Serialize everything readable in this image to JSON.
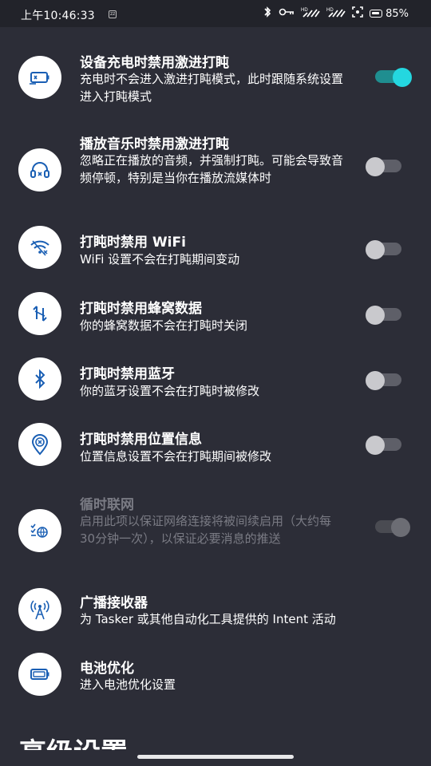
{
  "status_bar": {
    "time": "上午10:46:33",
    "zz_badge": "zz",
    "network1": "HD 2/4G",
    "network2": "HD 2/4G",
    "battery_percent": "85%"
  },
  "settings": [
    {
      "id": "disable-aggressive-charging",
      "title": "设备充电时禁用激进打盹",
      "desc": "充电时不会进入激进打盹模式，此时跟随系统设置进入打盹模式",
      "toggle": "on",
      "icon": "battery-charging-icon",
      "enabled": true
    },
    {
      "id": "disable-aggressive-music",
      "title": "播放音乐时禁用激进打盹",
      "desc": "忽略正在播放的音频，并强制打盹。可能会导致音频停顿，特别是当你在播放流媒体时",
      "toggle": "off",
      "icon": "headphones-icon",
      "enabled": true
    },
    {
      "id": "disable-wifi",
      "title": "打盹时禁用 WiFi",
      "desc": "WiFi 设置不会在打盹期间变动",
      "toggle": "off",
      "icon": "wifi-off-icon",
      "enabled": true
    },
    {
      "id": "disable-cellular",
      "title": "打盹时禁用蜂窝数据",
      "desc": "你的蜂窝数据不会在打盹时关闭",
      "toggle": "off",
      "icon": "cellular-data-icon",
      "enabled": true
    },
    {
      "id": "disable-bluetooth",
      "title": "打盹时禁用蓝牙",
      "desc": "你的蓝牙设置不会在打盹时被修改",
      "toggle": "off",
      "icon": "bluetooth-icon",
      "enabled": true
    },
    {
      "id": "disable-location",
      "title": "打盹时禁用位置信息",
      "desc": "位置信息设置不会在打盹期间被修改",
      "toggle": "off",
      "icon": "location-off-icon",
      "enabled": true
    },
    {
      "id": "periodic-network",
      "title": "循时联网",
      "desc": "启用此项以保证网络连接将被间续启用（大约每30分钟一次），以保证必要消息的推送",
      "toggle": "disabled-on",
      "icon": "network-schedule-icon",
      "enabled": false
    },
    {
      "id": "broadcast-receiver",
      "title": "广播接收器",
      "desc": "为 Tasker 或其他自动化工具提供的 Intent 活动",
      "toggle": null,
      "icon": "broadcast-tower-icon",
      "enabled": true
    },
    {
      "id": "battery-optimization",
      "title": "电池优化",
      "desc": "进入电池优化设置",
      "toggle": null,
      "icon": "battery-icon",
      "enabled": true
    }
  ],
  "next_section_title": "高级设置"
}
